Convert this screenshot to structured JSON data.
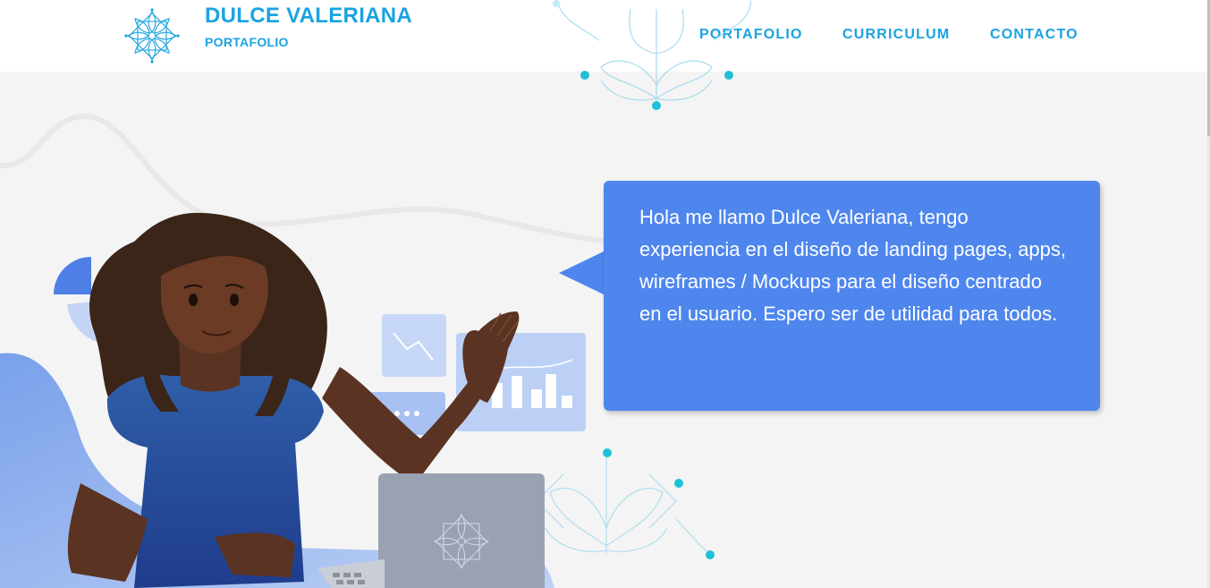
{
  "header": {
    "brand_title": "DULCE VALERIANA",
    "brand_subtitle": "PORTAFOLIO",
    "logo_icon": "mandala-flower-icon",
    "nav": [
      {
        "label": "PORTAFOLIO"
      },
      {
        "label": "CURRICULUM"
      },
      {
        "label": "CONTACTO"
      }
    ]
  },
  "hero": {
    "intro_text": "Hola me llamo Dulce Valeriana, tengo experiencia en el diseño de landing pages, apps, wireframes / Mockups para el diseño centrado en el usuario. Espero ser de utilidad para todos.",
    "illustration": "woman-waving-at-laptop-illustration"
  },
  "colors": {
    "brand": "#1aa3e0",
    "bubble": "#4e86ee",
    "background": "#f4f4f4",
    "accent_dot": "#1ec0d8"
  }
}
